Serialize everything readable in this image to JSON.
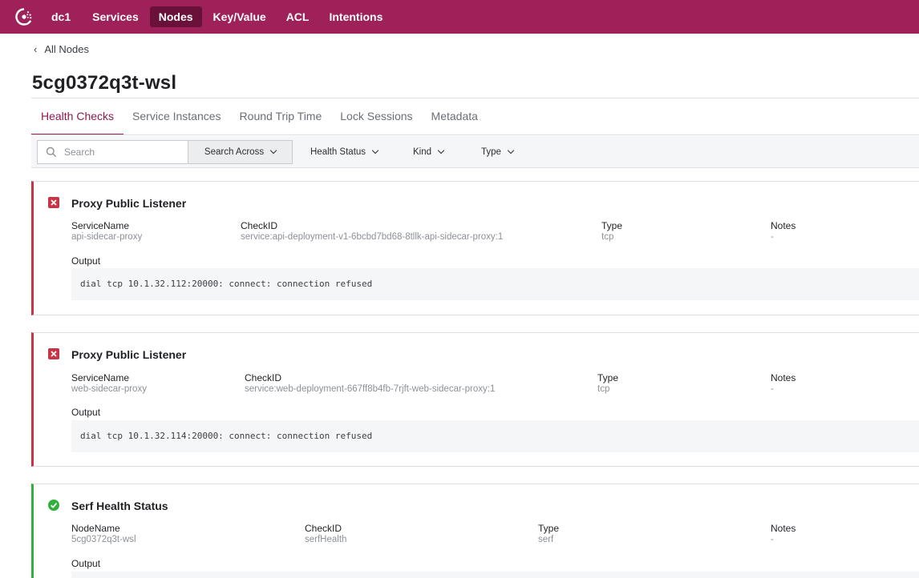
{
  "nav": {
    "logo_icon": "consul-logo-icon",
    "datacenter": "dc1",
    "items": [
      {
        "label": "Services",
        "active": false
      },
      {
        "label": "Nodes",
        "active": true
      },
      {
        "label": "Key/Value",
        "active": false
      },
      {
        "label": "ACL",
        "active": false
      },
      {
        "label": "Intentions",
        "active": false
      }
    ],
    "bg_color": "#9e2159"
  },
  "breadcrumb": {
    "label": "All Nodes",
    "icon": "chevron-left-icon"
  },
  "page_title": "5cg0372q3t-wsl",
  "tabs": [
    {
      "label": "Health Checks",
      "active": true
    },
    {
      "label": "Service Instances",
      "active": false
    },
    {
      "label": "Round Trip Time",
      "active": false
    },
    {
      "label": "Lock Sessions",
      "active": false
    },
    {
      "label": "Metadata",
      "active": false
    }
  ],
  "filters": {
    "search_placeholder": "Search",
    "search_across": "Search Across",
    "health_status": "Health Status",
    "kind": "Kind",
    "type": "Type"
  },
  "checks": [
    {
      "status": "critical",
      "status_icon": "error-x-icon",
      "status_color": "#c73445",
      "title": "Proxy Public Listener",
      "col1_label": "ServiceName",
      "col1_value": "api-sidecar-proxy",
      "checkid_label": "CheckID",
      "checkid_value": "service:api-deployment-v1-6bcbd7bd68-8tllk-api-sidecar-proxy:1",
      "type_label": "Type",
      "type_value": "tcp",
      "notes_label": "Notes",
      "notes_value": "-",
      "output_label": "Output",
      "output": "dial tcp 10.1.32.112:20000: connect: connection refused"
    },
    {
      "status": "critical",
      "status_icon": "error-x-icon",
      "status_color": "#c73445",
      "title": "Proxy Public Listener",
      "col1_label": "ServiceName",
      "col1_value": "web-sidecar-proxy",
      "checkid_label": "CheckID",
      "checkid_value": "service:web-deployment-667ff8b4fb-7rjft-web-sidecar-proxy:1",
      "type_label": "Type",
      "type_value": "tcp",
      "notes_label": "Notes",
      "notes_value": "-",
      "output_label": "Output",
      "output": "dial tcp 10.1.32.114:20000: connect: connection refused"
    },
    {
      "status": "passing",
      "status_icon": "check-circle-icon",
      "status_color": "#2eb039",
      "title": "Serf Health Status",
      "col1_label": "NodeName",
      "col1_value": "5cg0372q3t-wsl",
      "checkid_label": "CheckID",
      "checkid_value": "serfHealth",
      "type_label": "Type",
      "type_value": "serf",
      "notes_label": "Notes",
      "notes_value": "-",
      "output_label": "Output",
      "output": ""
    }
  ]
}
